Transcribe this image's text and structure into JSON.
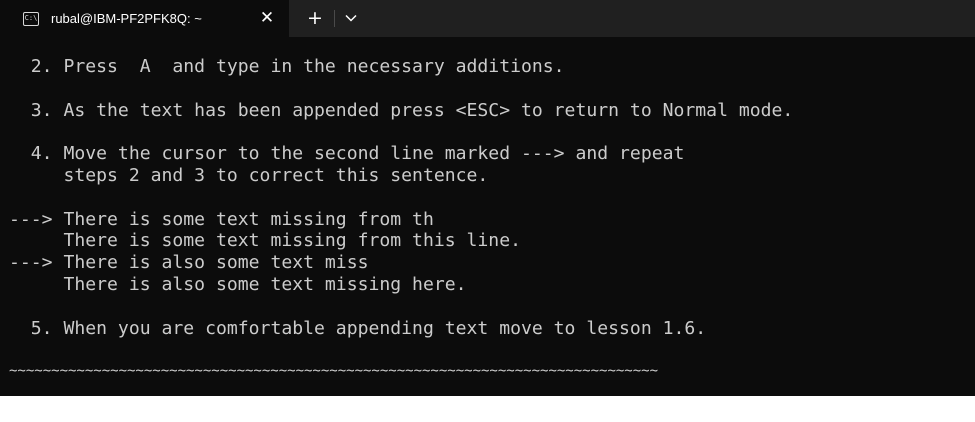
{
  "window": {
    "tab_icon_glyph": "C:\\",
    "tab_title": "rubal@IBM-PF2PFK8Q: ~",
    "close_glyph": "✕",
    "new_tab_glyph": "+",
    "icons": [
      "terminal-icon",
      "close-icon",
      "plus-icon",
      "chevron-down-icon"
    ]
  },
  "terminal": {
    "lines": [
      "",
      "  2. Press  A  and type in the necessary additions.",
      "",
      "  3. As the text has been appended press <ESC> to return to Normal mode.",
      "",
      "  4. Move the cursor to the second line marked ---> and repeat",
      "     steps 2 and 3 to correct this sentence.",
      "",
      "---> There is some text missing from th",
      "     There is some text missing from this line.",
      "---> There is also some text miss",
      "     There is also some text missing here.",
      "",
      "  5. When you are comfortable appending text move to lesson 1.6.",
      "",
      "~~~~~~~~~~~~~~~~~~~~~~~~~~~~~~~~~~~~~~~~~~~~~~~~~~~~~~~~~~~~~~~~~~~~~~~~~~~~~"
    ]
  },
  "colors": {
    "terminal_bg": "#0c0c0c",
    "titlebar_bg": "#202020",
    "text": "#cccccc"
  }
}
